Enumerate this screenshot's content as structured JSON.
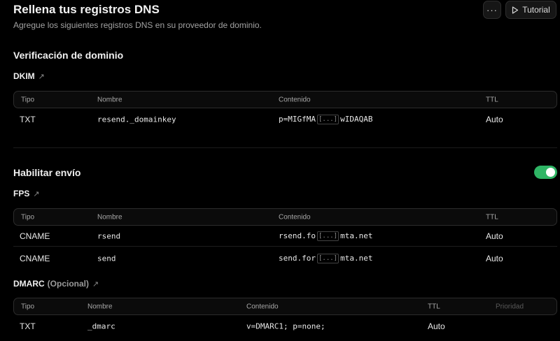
{
  "header": {
    "title": "Rellena tus registros DNS",
    "subtitle": "Agregue los siguientes registros DNS en su proveedor de dominio.",
    "more_label": "···",
    "tutorial_label": "Tutorial"
  },
  "verification": {
    "title": "Verificación de dominio",
    "dkim": {
      "label": "DKIM",
      "columns": [
        "Tipo",
        "Nombre",
        "Contenido",
        "TTL"
      ],
      "rows": [
        {
          "type": "TXT",
          "name": "resend._domainkey",
          "content_start": "p=MIGfMA",
          "content_trunc": "[...]",
          "content_end": "wIDAQAB",
          "ttl": "Auto"
        }
      ]
    }
  },
  "sending": {
    "title": "Habilitar envío",
    "enabled": true,
    "toggle_color": "#2fb565",
    "fps": {
      "label": "FPS",
      "columns": [
        "Tipo",
        "Nombre",
        "Contenido",
        "TTL"
      ],
      "rows": [
        {
          "type": "CNAME",
          "name": "rsend",
          "content_start": "rsend.fo",
          "content_trunc": "[...]",
          "content_end": "mta.net",
          "ttl": "Auto"
        },
        {
          "type": "CNAME",
          "name": "send",
          "content_start": "send.for",
          "content_trunc": "[...]",
          "content_end": "mta.net",
          "ttl": "Auto"
        }
      ]
    }
  },
  "dmarc": {
    "label": "DMARC",
    "optional": "(Opcional)",
    "columns": [
      "Tipo",
      "Nombre",
      "Contenido",
      "TTL",
      "Prioridad"
    ],
    "rows": [
      {
        "type": "TXT",
        "name": "_dmarc",
        "content": "v=DMARC1; p=none;",
        "ttl": "Auto"
      }
    ]
  }
}
